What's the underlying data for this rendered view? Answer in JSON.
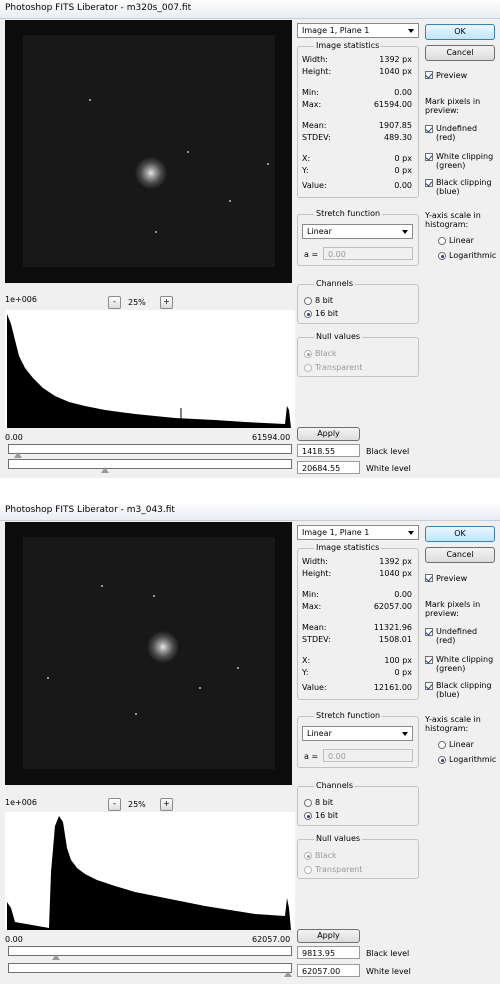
{
  "dialogs": [
    {
      "title": "Photoshop FITS Liberator - m320s_007.fit",
      "zoom": "25%",
      "histogram_top_label": "1e+006",
      "histogram_min": "0.00",
      "histogram_max": "61594.00",
      "apply_label": "Apply",
      "black_level": "1418.55",
      "black_level_label": "Black level",
      "white_level": "20684.55",
      "white_level_label": "White level",
      "black_marker_fraction": 0.023,
      "white_marker_fraction": 0.336,
      "image_select": "Image 1, Plane 1",
      "ok_label": "OK",
      "cancel_label": "Cancel",
      "preview_label": "Preview",
      "stats_title": "Image statistics",
      "stats": {
        "width_k": "Width:",
        "width_v": "1392 px",
        "height_k": "Height:",
        "height_v": "1040 px",
        "min_k": "Min:",
        "min_v": "0.00",
        "max_k": "Max:",
        "max_v": "61594.00",
        "mean_k": "Mean:",
        "mean_v": "1907.85",
        "stdev_k": "STDEV:",
        "stdev_v": "489.30",
        "x_k": "X:",
        "x_v": "0 px",
        "y_k": "Y:",
        "y_v": "0 px",
        "value_k": "Value:",
        "value_v": "0.00"
      },
      "stretch_title": "Stretch function",
      "stretch_value": "Linear",
      "a_label": "a =",
      "a_value": "0.00",
      "channels_title": "Channels",
      "ch_8": "8 bit",
      "ch_16": "16 bit",
      "null_title": "Null values",
      "null_black": "Black",
      "null_transparent": "Transparent",
      "mark_title": "Mark pixels in preview:",
      "mark_undefined": "Undefined (red)",
      "mark_white": "White clipping (green)",
      "mark_black": "Black clipping (blue)",
      "yaxis_title": "Y-axis scale in histogram:",
      "yaxis_linear": "Linear",
      "yaxis_log": "Logarithmic"
    },
    {
      "title": "Photoshop FITS Liberator - m3_043.fit",
      "zoom": "25%",
      "histogram_top_label": "1e+006",
      "histogram_min": "0.00",
      "histogram_max": "62057.00",
      "apply_label": "Apply",
      "black_level": "9813.95",
      "black_level_label": "Black level",
      "white_level": "62057.00",
      "white_level_label": "White level",
      "black_marker_fraction": 0.158,
      "white_marker_fraction": 1.0,
      "image_select": "Image 1, Plane 1",
      "ok_label": "OK",
      "cancel_label": "Cancel",
      "preview_label": "Preview",
      "stats_title": "Image statistics",
      "stats": {
        "width_k": "Width:",
        "width_v": "1392 px",
        "height_k": "Height:",
        "height_v": "1040 px",
        "min_k": "Min:",
        "min_v": "0.00",
        "max_k": "Max:",
        "max_v": "62057.00",
        "mean_k": "Mean:",
        "mean_v": "11321.96",
        "stdev_k": "STDEV:",
        "stdev_v": "1508.01",
        "x_k": "X:",
        "x_v": "100 px",
        "y_k": "Y:",
        "y_v": "0 px",
        "value_k": "Value:",
        "value_v": "12161.00"
      },
      "stretch_title": "Stretch function",
      "stretch_value": "Linear",
      "a_label": "a =",
      "a_value": "0.00",
      "channels_title": "Channels",
      "ch_8": "8 bit",
      "ch_16": "16 bit",
      "null_title": "Null values",
      "null_black": "Black",
      "null_transparent": "Transparent",
      "mark_title": "Mark pixels in preview:",
      "mark_undefined": "Undefined (red)",
      "mark_white": "White clipping (green)",
      "mark_black": "Black clipping (blue)",
      "yaxis_title": "Y-axis scale in histogram:",
      "yaxis_linear": "Linear",
      "yaxis_log": "Logarithmic"
    }
  ]
}
